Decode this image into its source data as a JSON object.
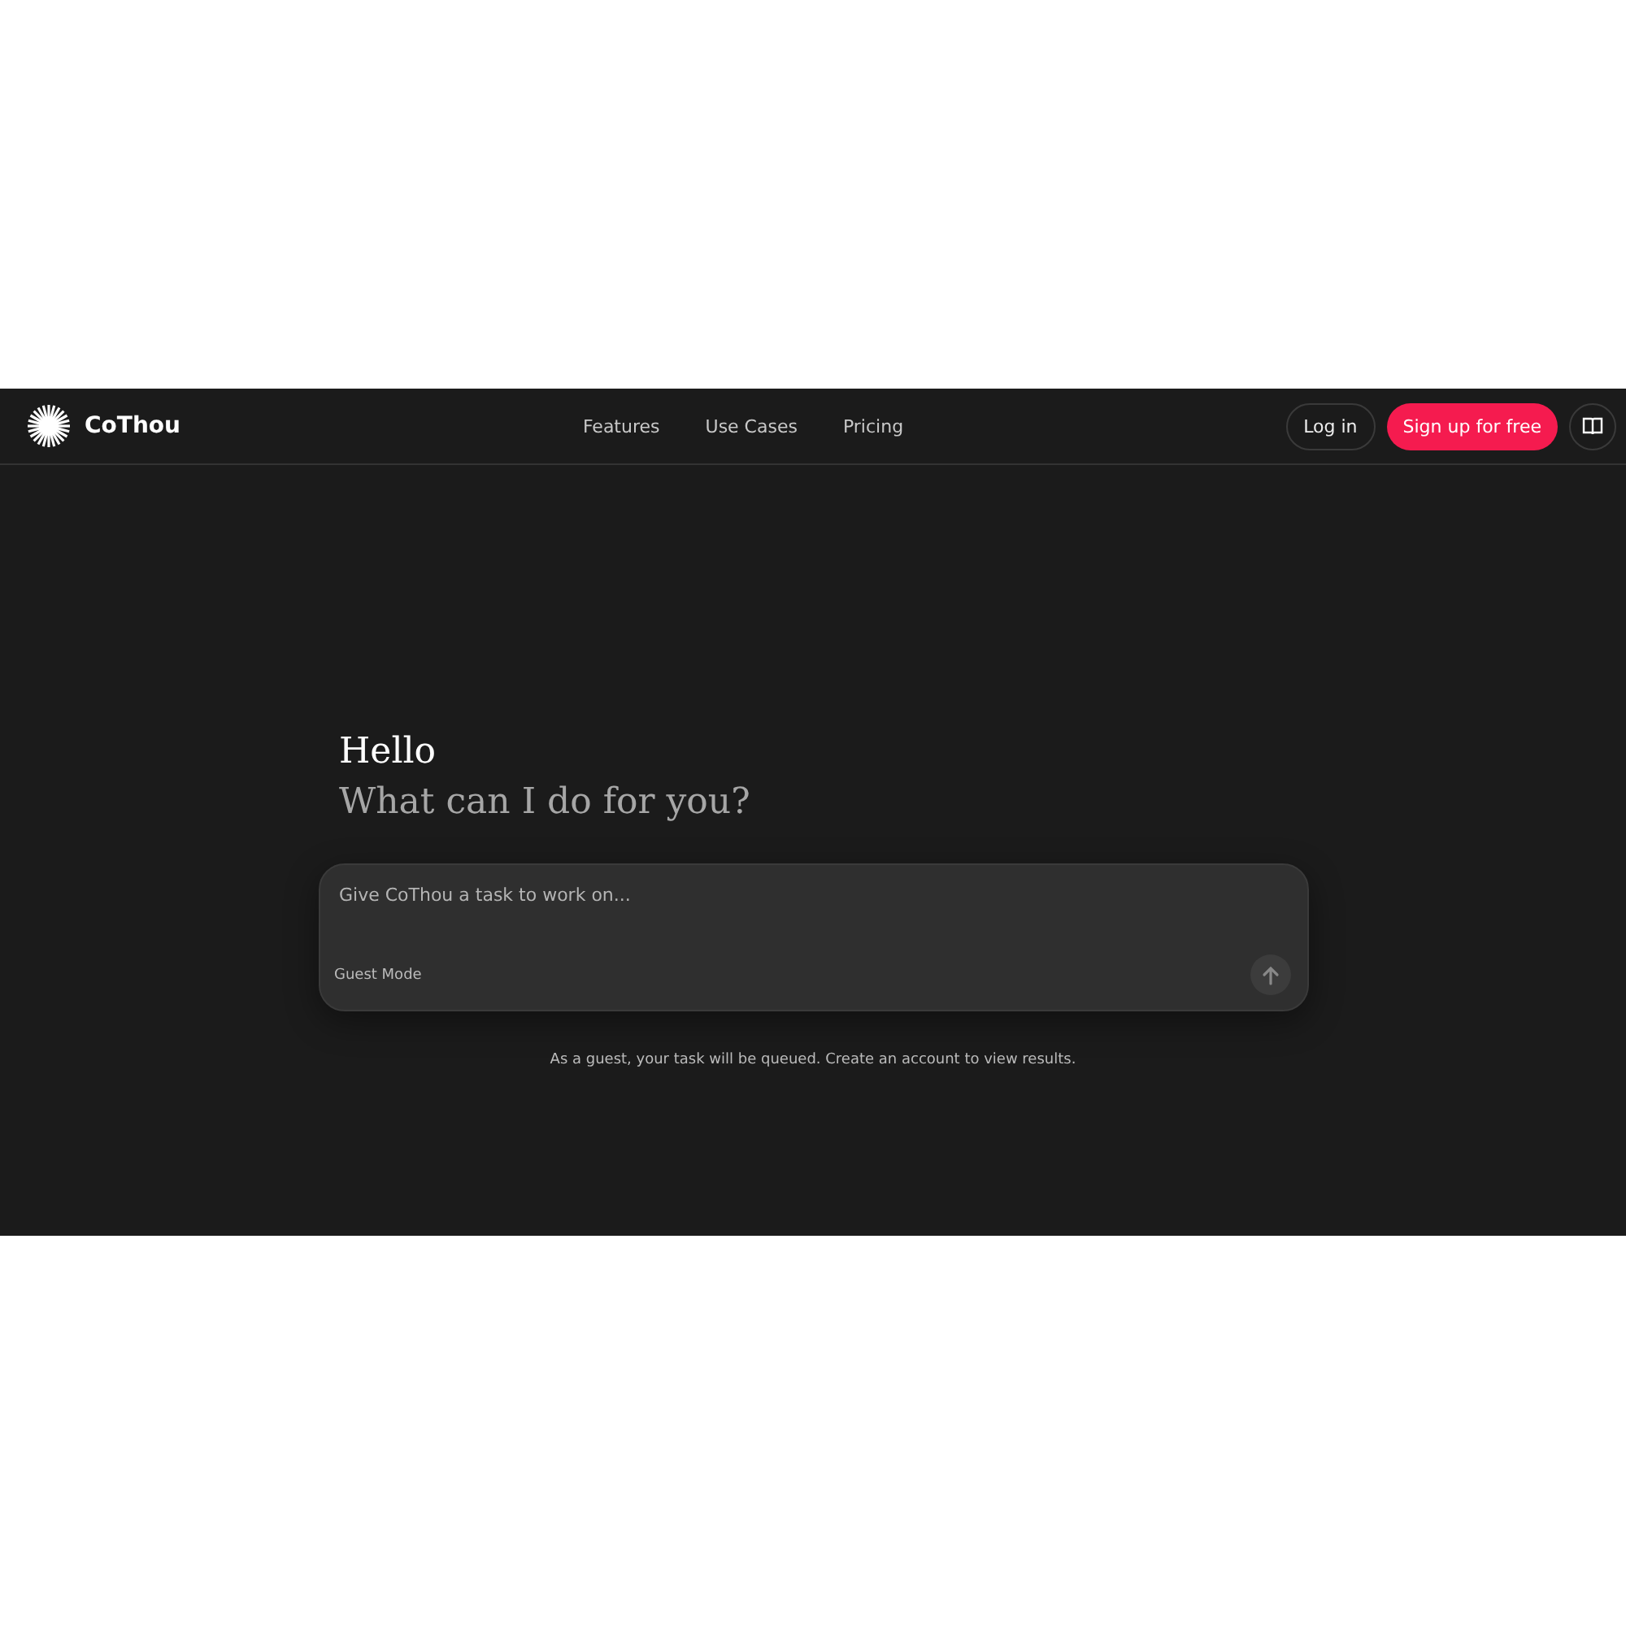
{
  "header": {
    "brand": "CoThou",
    "nav": [
      {
        "label": "Features"
      },
      {
        "label": "Use Cases"
      },
      {
        "label": "Pricing"
      }
    ],
    "login": "Log in",
    "signup": "Sign up for free"
  },
  "hero": {
    "greeting": "Hello",
    "question": "What can I do for you?"
  },
  "prompt": {
    "placeholder": "Give CoThou a task to work on...",
    "mode": "Guest Mode",
    "send_disabled": true
  },
  "note": "As a guest, your task will be queued. Create an account to view results."
}
